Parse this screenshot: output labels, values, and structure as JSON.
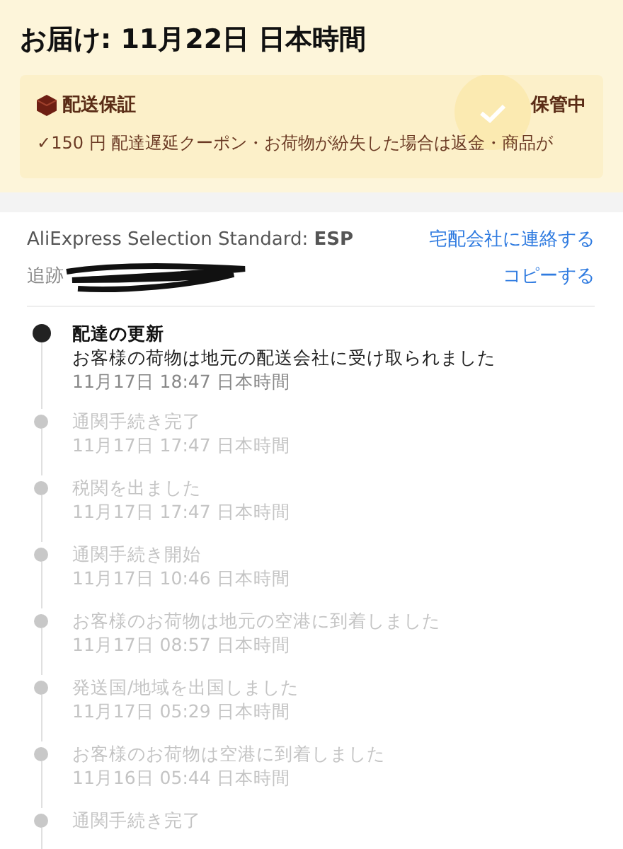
{
  "delivery": {
    "title": "お届け: 11月22日 日本時間"
  },
  "guarantee": {
    "title": "配送保証",
    "status": "保管中",
    "check": "✓",
    "details": "150 円 配達遅延クーポン・お荷物が紛失した場合は返金・商品が"
  },
  "shipping": {
    "carrier": "AliExpress Selection Standard: **ESP**",
    "contact_link": "宅配会社に連絡する",
    "tracking_label": "追跡",
    "copy_link": "コピーする"
  },
  "timeline": [
    {
      "title": "配達の更新",
      "description": "お客様の荷物は地元の配送会社に受け取られました",
      "time": "11月17日 18:47 日本時間",
      "current": true
    },
    {
      "title": "通関手続き完了",
      "time": "11月17日 17:47 日本時間",
      "current": false
    },
    {
      "title": "税関を出ました",
      "time": "11月17日 17:47 日本時間",
      "current": false
    },
    {
      "title": "通関手続き開始",
      "time": "11月17日 10:46 日本時間",
      "current": false
    },
    {
      "title": "お客様のお荷物は地元の空港に到着しました",
      "time": "11月17日 08:57 日本時間",
      "current": false
    },
    {
      "title": "発送国/地域を出国しました",
      "time": "11月17日 05:29 日本時間",
      "current": false
    },
    {
      "title": "お客様のお荷物は空港に到着しました",
      "time": "11月16日 05:44 日本時間",
      "current": false
    },
    {
      "title": "通関手続き完了",
      "current": false
    }
  ]
}
